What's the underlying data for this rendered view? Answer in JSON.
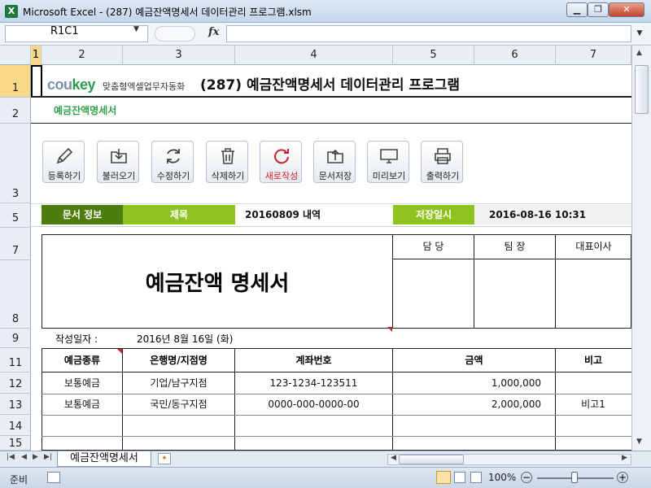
{
  "window": {
    "title": "Microsoft Excel - (287) 예금잔액명세서 데이터관리 프로그램.xlsm",
    "app_icon": "X"
  },
  "formula_bar": {
    "name_box": "R1C1",
    "fx": "fx",
    "formula": ""
  },
  "columns": [
    "1",
    "2",
    "3",
    "4",
    "5",
    "6",
    "7"
  ],
  "rows": [
    "1",
    "2",
    "3",
    "5",
    "7",
    "8",
    "9",
    "11",
    "12",
    "13",
    "14",
    "15"
  ],
  "brand": {
    "co": "cou",
    "key": "key",
    "tagline": "맞춤형엑셀업무자동화"
  },
  "sheet_title": "(287) 예금잔액명세서 데이터관리 프로그램",
  "subtitle": "예금잔액명세서",
  "toolbar": [
    {
      "label": "등록하기",
      "icon": "pencil-icon"
    },
    {
      "label": "불러오기",
      "icon": "download-folder-icon"
    },
    {
      "label": "수정하기",
      "icon": "refresh-icon"
    },
    {
      "label": "삭제하기",
      "icon": "trash-icon"
    },
    {
      "label": "새로작성",
      "icon": "new-refresh-icon"
    },
    {
      "label": "문서저장",
      "icon": "upload-folder-icon"
    },
    {
      "label": "미리보기",
      "icon": "monitor-icon"
    },
    {
      "label": "출력하기",
      "icon": "printer-icon"
    }
  ],
  "doc_info": {
    "section_label": "문서 정보",
    "title_label": "제목",
    "title_value": "20160809 내역",
    "saved_label": "저장일시",
    "saved_value": "2016-08-16 10:31"
  },
  "document": {
    "heading": "예금잔액 명세서",
    "approvals": [
      "담 당",
      "팀 장",
      "대표이사"
    ],
    "written_label": "작성일자 :",
    "written_value": "2016년 8월 16일 (화)"
  },
  "table": {
    "headers": [
      "예금종류",
      "은행명/지점명",
      "계좌번호",
      "금액",
      "비고"
    ],
    "rows": [
      [
        "보통예금",
        "기업/남구지점",
        "123-1234-123511",
        "1,000,000",
        ""
      ],
      [
        "보통예금",
        "국민/동구지점",
        "0000-000-0000-00",
        "2,000,000",
        "비고1"
      ],
      [
        "",
        "",
        "",
        "",
        ""
      ]
    ]
  },
  "sheet_tab": "예금잔액명세서",
  "status": {
    "ready": "준비",
    "zoom": "100%"
  },
  "colors": {
    "dark_green": "#4f7c0f",
    "light_green": "#8dc21f",
    "brand_green": "#2c9a4a"
  }
}
